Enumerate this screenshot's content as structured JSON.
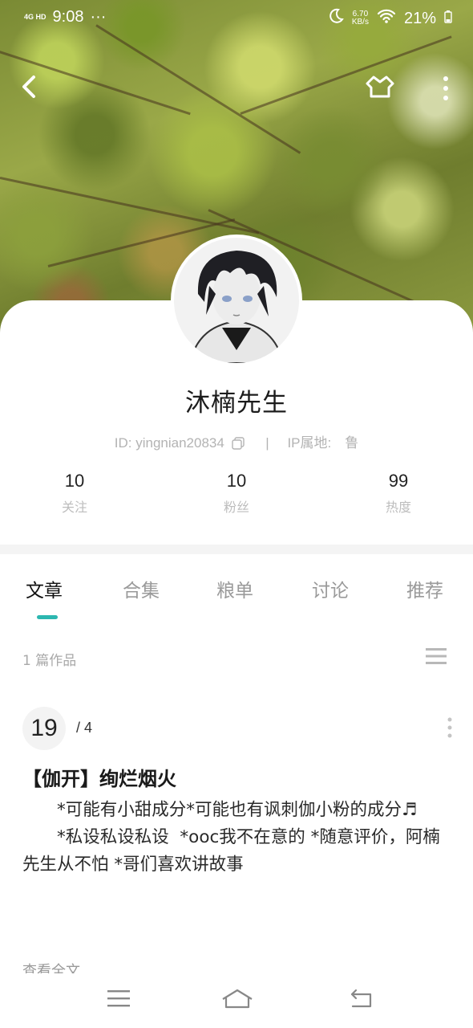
{
  "status_bar": {
    "signal": "4G HD",
    "time": "9:08",
    "dots": "···",
    "net_speed_value": "6.70",
    "net_speed_unit": "KB/s",
    "battery": "21%"
  },
  "header": {
    "icons": [
      "back-icon",
      "hanger-icon",
      "more-vert-icon"
    ]
  },
  "profile": {
    "name": "沐楠先生",
    "id_text": "ID: yingnian20834",
    "separator": "|",
    "ip_text": "IP属地:　鲁",
    "stats": [
      {
        "value": "10",
        "label": "关注"
      },
      {
        "value": "10",
        "label": "粉丝"
      },
      {
        "value": "99",
        "label": "热度"
      }
    ]
  },
  "tabs": [
    {
      "label": "文章",
      "active": true
    },
    {
      "label": "合集",
      "active": false
    },
    {
      "label": "粮单",
      "active": false
    },
    {
      "label": "讨论",
      "active": false
    },
    {
      "label": "推荐",
      "active": false
    }
  ],
  "works": {
    "count_text": "1 篇作品"
  },
  "article": {
    "day": "19",
    "month": "/ 4",
    "title": "【伽开】绚烂烟火",
    "body": "　　*可能有小甜成分*可能也有讽刺伽小粉的成分♬\n　　*私设私设私设  *ooc我不在意的 *随意评价，阿楠先生从不怕 *哥们喜欢讲故事",
    "read_more": "查看全文"
  },
  "colors": {
    "accent": "#2cb7b0",
    "muted": "#b3b3b3"
  }
}
